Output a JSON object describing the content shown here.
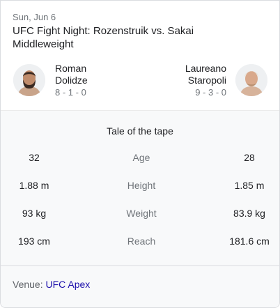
{
  "event": {
    "date": "Sun, Jun 6",
    "title": "UFC Fight Night: Rozenstruik vs. Sakai",
    "division": "Middleweight"
  },
  "fighters": {
    "left": {
      "first": "Roman",
      "last": "Dolidze",
      "record": "8 - 1 - 0"
    },
    "right": {
      "first": "Laureano",
      "last": "Staropoli",
      "record": "9 - 3 - 0"
    }
  },
  "tape": {
    "title": "Tale of the tape",
    "rows": [
      {
        "left": "32",
        "label": "Age",
        "right": "28"
      },
      {
        "left": "1.88 m",
        "label": "Height",
        "right": "1.85 m"
      },
      {
        "left": "93 kg",
        "label": "Weight",
        "right": "83.9 kg"
      },
      {
        "left": "193 cm",
        "label": "Reach",
        "right": "181.6 cm"
      }
    ]
  },
  "venue": {
    "label": "Venue:",
    "link": "UFC Apex"
  },
  "colors": {
    "link": "#1a0dab",
    "muted": "#70757a",
    "text": "#202124"
  }
}
